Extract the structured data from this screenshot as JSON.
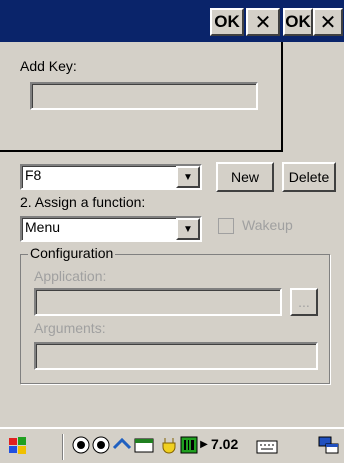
{
  "titlebar": {
    "ok_label": "OK",
    "close_glyph": "✕"
  },
  "dialog": {
    "ok_label": "OK",
    "close_glyph": "✕",
    "field_label": "Add Key:",
    "field_value": ""
  },
  "main": {
    "key_value": "F8",
    "new_label": "New",
    "delete_label": "Delete",
    "assign_label": "2. Assign a function:",
    "function_value": "Menu",
    "wakeup_label": "Wakeup",
    "wakeup_checked": false,
    "config_group_label": "Configuration",
    "application_label": "Application:",
    "application_value": "",
    "browse_label": "...",
    "arguments_label": "Arguments:",
    "arguments_value": ""
  },
  "taskbar": {
    "battery_value": "7.02",
    "icons": [
      "start-flag-icon",
      "network-icon",
      "network-icon",
      "connection-icon",
      "keyboard-125-icon",
      "power-plug-icon",
      "barcode-icon",
      "volume-arrow-icon",
      "keyboard-icon",
      "window-switch-icon"
    ]
  },
  "colors": {
    "title_blue": "#0a246a",
    "face": "#d4d0c8",
    "dim_text": "#a0a0a0"
  }
}
